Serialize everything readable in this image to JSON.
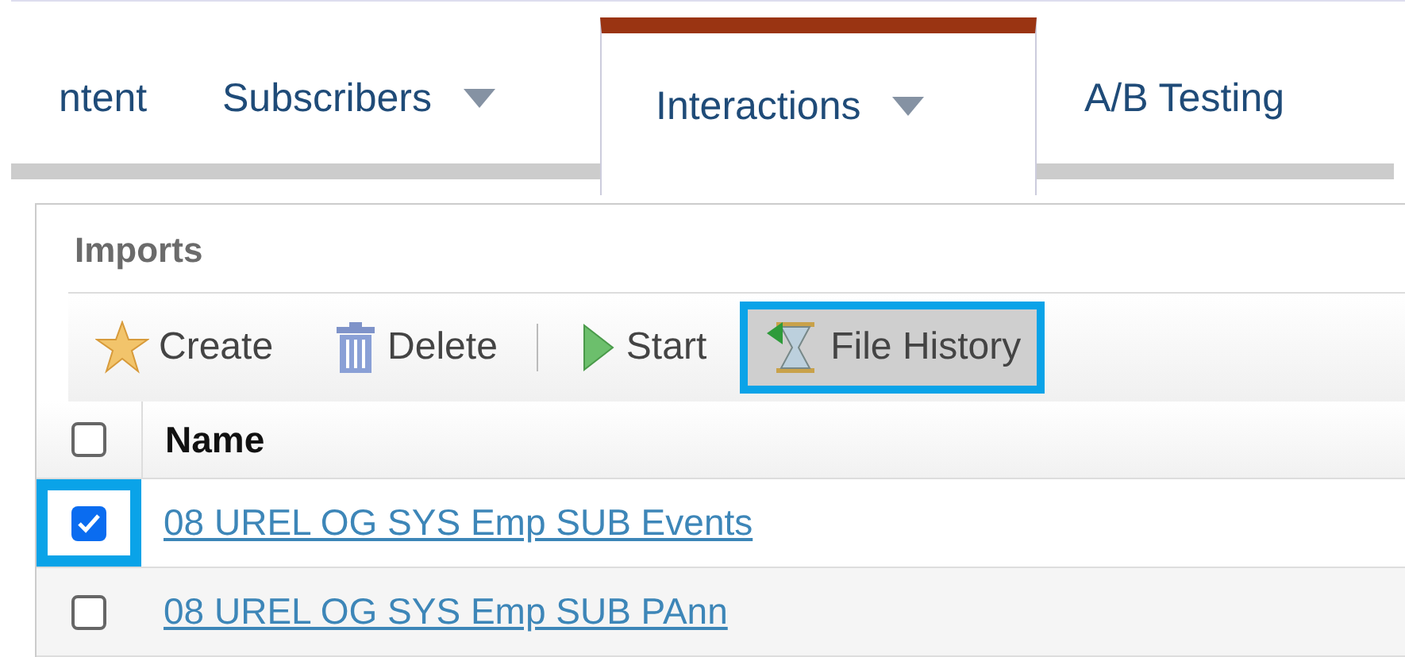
{
  "tabs": [
    {
      "label": "ntent",
      "selected": false,
      "dropdown": false
    },
    {
      "label": "Subscribers",
      "selected": false,
      "dropdown": true
    },
    {
      "label": "Interactions",
      "selected": true,
      "dropdown": true
    },
    {
      "label": "A/B Testing",
      "selected": false,
      "dropdown": false
    }
  ],
  "panel": {
    "title": "Imports",
    "toolbar": [
      {
        "kind": "create",
        "label": "Create",
        "highlighted": false
      },
      {
        "kind": "delete",
        "label": "Delete",
        "highlighted": false
      },
      {
        "kind": "separator"
      },
      {
        "kind": "start",
        "label": "Start",
        "highlighted": false
      },
      {
        "kind": "history",
        "label": "File History",
        "highlighted": true
      }
    ],
    "table": {
      "columns": [
        "Name"
      ],
      "header_checked": false,
      "rows": [
        {
          "name": "08 UREL OG SYS Emp SUB Events",
          "checked": true,
          "highlighted": true
        },
        {
          "name": "08 UREL OG SYS Emp SUB PAnn",
          "checked": false,
          "highlighted": false
        }
      ]
    }
  }
}
